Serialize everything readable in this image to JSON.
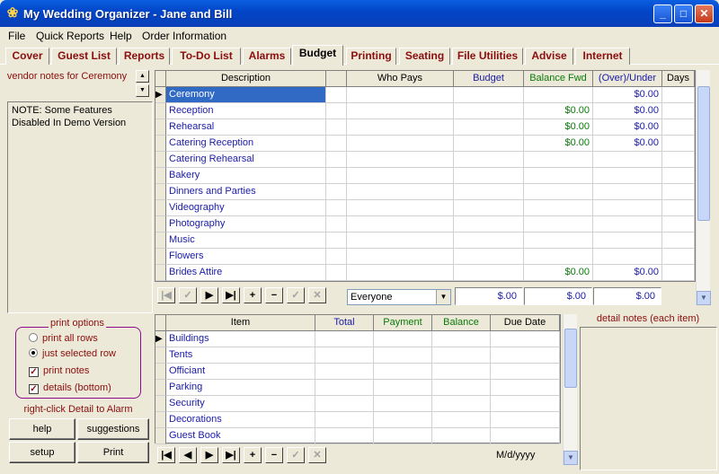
{
  "window": {
    "title": "My Wedding Organizer - Jane and Bill"
  },
  "menu": [
    "File",
    "Quick Reports",
    "Help",
    "Order Information"
  ],
  "tabs": [
    "Cover",
    "Guest List",
    "Reports",
    "To-Do List",
    "Alarms",
    "Budget",
    "Printing",
    "Seating",
    "File Utilities",
    "Advise",
    "Internet"
  ],
  "active_tab": "Budget",
  "left": {
    "vendor_label": "vendor notes for Ceremony",
    "note": "NOTE: Some Features Disabled In Demo Version"
  },
  "budget": {
    "headers": [
      "Description",
      "",
      "Who Pays",
      "Budget",
      "Balance Fwd",
      "(Over)/Under",
      "Days"
    ],
    "rows": [
      {
        "description": "Ceremony",
        "balance_fwd": "",
        "over_under": "$0.00"
      },
      {
        "description": "Reception",
        "balance_fwd": "$0.00",
        "over_under": "$0.00"
      },
      {
        "description": "Rehearsal",
        "balance_fwd": "$0.00",
        "over_under": "$0.00"
      },
      {
        "description": "Catering Reception",
        "balance_fwd": "$0.00",
        "over_under": "$0.00"
      },
      {
        "description": "Catering Rehearsal",
        "balance_fwd": "",
        "over_under": ""
      },
      {
        "description": "Bakery",
        "balance_fwd": "",
        "over_under": ""
      },
      {
        "description": "Dinners and Parties",
        "balance_fwd": "",
        "over_under": ""
      },
      {
        "description": "Videography",
        "balance_fwd": "",
        "over_under": ""
      },
      {
        "description": "Photography",
        "balance_fwd": "",
        "over_under": ""
      },
      {
        "description": "Music",
        "balance_fwd": "",
        "over_under": ""
      },
      {
        "description": "Flowers",
        "balance_fwd": "",
        "over_under": ""
      },
      {
        "description": "Brides Attire",
        "balance_fwd": "$0.00",
        "over_under": "$0.00"
      }
    ],
    "who_pays_filter": "Everyone",
    "totals": {
      "budget": "$.00",
      "balance_fwd": "$.00",
      "over_under": "$.00"
    }
  },
  "detail": {
    "headers": [
      "Item",
      "Total",
      "Payment",
      "Balance",
      "Due Date"
    ],
    "rows": [
      "Buildings",
      "Tents",
      "Officiant",
      "Parking",
      "Security",
      "Decorations",
      "Guest Book"
    ],
    "date_format": "M/d/yyyy",
    "notes_label": "detail notes (each item)"
  },
  "print_options": {
    "label": "print options",
    "radio_all": "print all rows",
    "radio_selected": "just selected row",
    "check_notes": "print notes",
    "check_details": "details (bottom)"
  },
  "hint": "right-click Detail to Alarm",
  "buttons": {
    "help": "help",
    "suggestions": "suggestions",
    "setup": "setup",
    "print": "Print"
  },
  "colors": {
    "title_blue": "#0246C8",
    "tab_text": "#8B0D0D",
    "link_blue": "#1a1aa8",
    "money_green": "#0a7a0a"
  }
}
